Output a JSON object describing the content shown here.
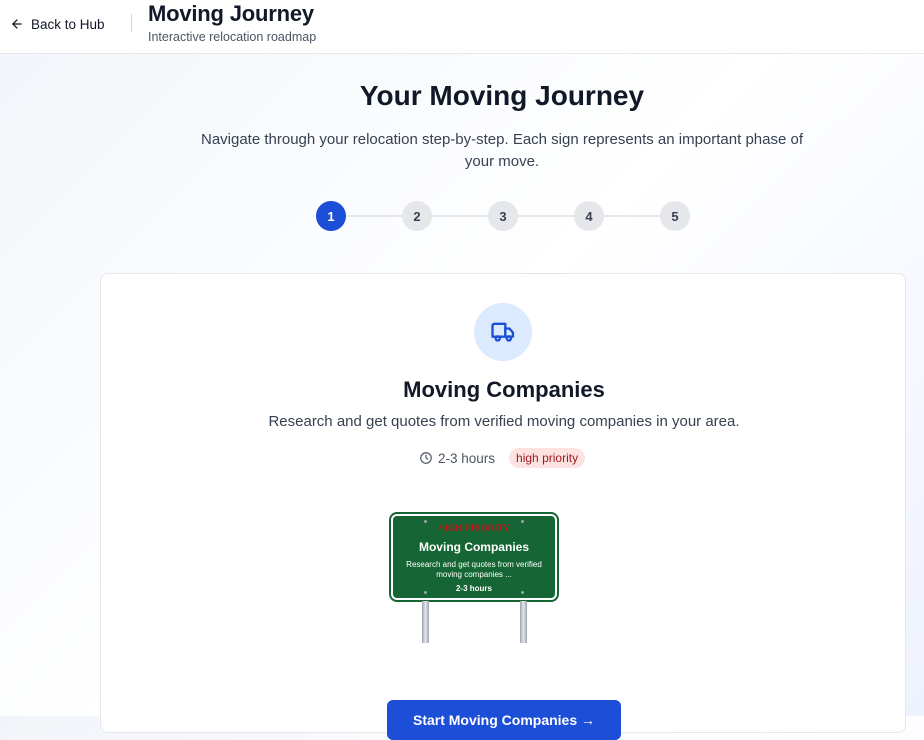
{
  "header": {
    "back_label": "Back to Hub",
    "title": "Moving Journey",
    "subtitle": "Interactive relocation roadmap"
  },
  "hero": {
    "title": "Your Moving Journey",
    "description": "Navigate through your relocation step-by-step. Each sign represents an important phase of your move."
  },
  "stepper": {
    "steps": [
      "1",
      "2",
      "3",
      "4",
      "5"
    ],
    "active": "1"
  },
  "card": {
    "icon": "truck-icon",
    "title": "Moving Companies",
    "description": "Research and get quotes from verified moving companies in your area.",
    "time": "2-3 hours",
    "priority": "high priority",
    "sign": {
      "priority": "HIGH PRIORITY",
      "title": "Moving Companies",
      "description": "Research and get quotes from verified moving companies ...",
      "time": "2-3 hours"
    },
    "cta_label": "Start Moving Companies →"
  },
  "colors": {
    "accent": "#1d4ed8",
    "sign_green": "#166534",
    "badge_bg": "#fee2e2",
    "badge_text": "#991b1b"
  }
}
